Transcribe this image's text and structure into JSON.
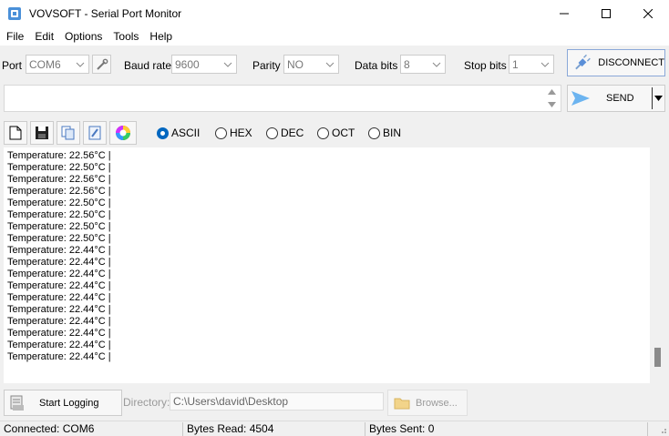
{
  "window": {
    "title": "VOVSOFT - Serial Port Monitor",
    "accent": "#1e6fd9"
  },
  "menu": [
    "File",
    "Edit",
    "Options",
    "Tools",
    "Help"
  ],
  "settings": {
    "port_label": "Port",
    "port_value": "COM6",
    "baud_label": "Baud rate",
    "baud_value": "9600",
    "parity_label": "Parity",
    "parity_value": "NO",
    "databits_label": "Data bits",
    "databits_value": "8",
    "stopbits_label": "Stop bits",
    "stopbits_value": "1",
    "disconnect_label": "DISCONNECT"
  },
  "send": {
    "input_value": "",
    "send_label": "SEND"
  },
  "display_modes": {
    "options": [
      "ASCII",
      "HEX",
      "DEC",
      "OCT",
      "BIN"
    ],
    "selected": "ASCII"
  },
  "console": {
    "lines": [
      "Temperature: 22.56°C |",
      "Temperature: 22.50°C |",
      "Temperature: 22.56°C |",
      "Temperature: 22.56°C |",
      "Temperature: 22.50°C |",
      "Temperature: 22.50°C |",
      "Temperature: 22.50°C |",
      "Temperature: 22.50°C |",
      "Temperature: 22.44°C |",
      "Temperature: 22.44°C |",
      "Temperature: 22.44°C |",
      "Temperature: 22.44°C |",
      "Temperature: 22.44°C |",
      "Temperature: 22.44°C |",
      "Temperature: 22.44°C |",
      "Temperature: 22.44°C |",
      "Temperature: 22.44°C |",
      "Temperature: 22.44°C |"
    ]
  },
  "logging": {
    "start_label": "Start Logging",
    "directory_label": "Directory:",
    "directory_value": "C:\\Users\\david\\Desktop",
    "browse_label": "Browse..."
  },
  "status": {
    "connection": "Connected: COM6",
    "bytes_read": "Bytes Read: 4504",
    "bytes_sent": "Bytes Sent: 0"
  }
}
